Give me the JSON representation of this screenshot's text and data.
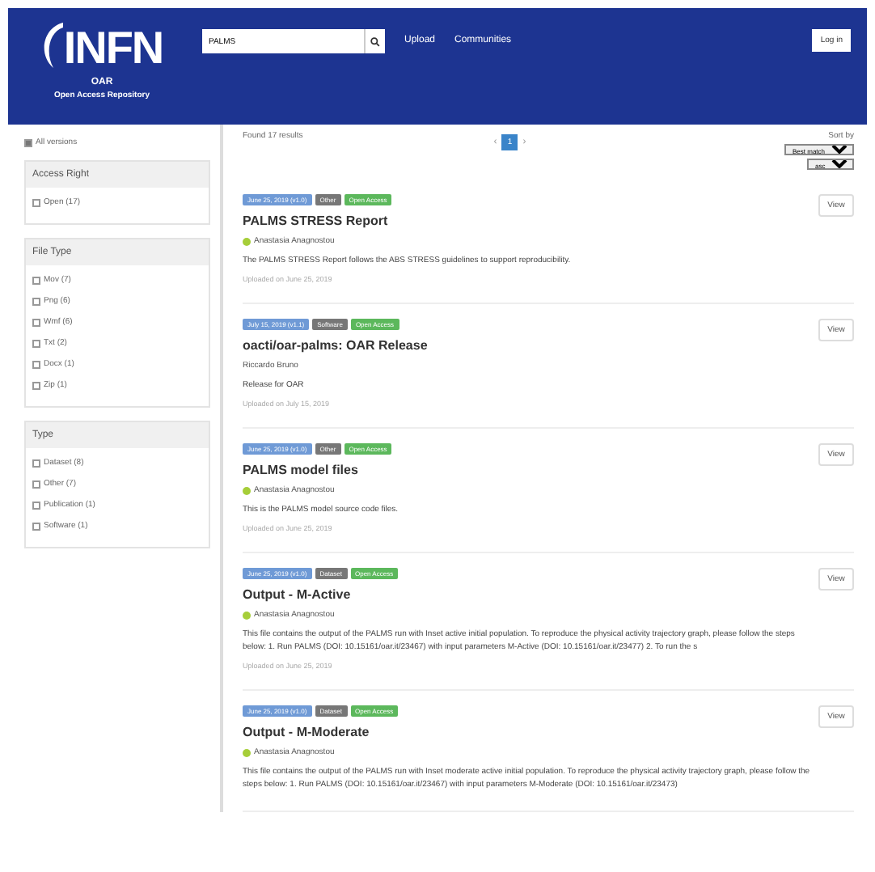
{
  "header": {
    "logo": "INFN",
    "logo_sub": "OAR",
    "logo_tagline": "Open Access Repository",
    "search": {
      "value": "PALMS"
    },
    "links": [
      "Upload",
      "Communities"
    ],
    "login": "Log in"
  },
  "sidebar": {
    "all_versions": {
      "label": "All versions",
      "checked": true
    },
    "facets": [
      {
        "title": "Access Right",
        "options": [
          {
            "label": "Open (17)",
            "checked": false
          }
        ]
      },
      {
        "title": "File Type",
        "options": [
          {
            "label": "Mov (7)",
            "checked": false
          },
          {
            "label": "Png (6)",
            "checked": false
          },
          {
            "label": "Wmf (6)",
            "checked": false
          },
          {
            "label": "Txt (2)",
            "checked": false
          },
          {
            "label": "Docx (1)",
            "checked": false
          },
          {
            "label": "Zip (1)",
            "checked": false
          }
        ]
      },
      {
        "title": "Type",
        "options": [
          {
            "label": "Dataset (8)",
            "checked": false
          },
          {
            "label": "Other (7)",
            "checked": false
          },
          {
            "label": "Publication (1)",
            "checked": false
          },
          {
            "label": "Software (1)",
            "checked": false
          }
        ]
      }
    ]
  },
  "results": {
    "count": "Found 17 results",
    "pages": [
      {
        "label": "1",
        "selected": true
      }
    ],
    "prev": "‹",
    "next": "›",
    "sort_label": "Sort by",
    "sort": "Best match",
    "order": "asc",
    "records": [
      {
        "date": "June 25, 2019 (v1.0)",
        "type": "Other",
        "access": "Open Access",
        "title": "PALMS STRESS Report",
        "author": "Anastasia Anagnostou",
        "has_orcid": true,
        "description": "The PALMS STRESS Report follows the ABS STRESS guidelines to support reproducibility.",
        "uploaded": "Uploaded on June 25, 2019",
        "view": "View"
      },
      {
        "date": "July 15, 2019 (v1.1)",
        "type": "Software",
        "access": "Open Access",
        "title": "oacti/oar-palms: OAR Release",
        "author": "Riccardo Bruno",
        "has_orcid": false,
        "description": "Release for OAR",
        "uploaded": "Uploaded on July 15, 2019",
        "view": "View"
      },
      {
        "date": "June 25, 2019 (v1.0)",
        "type": "Other",
        "access": "Open Access",
        "title": "PALMS model files",
        "author": "Anastasia Anagnostou",
        "has_orcid": true,
        "description": "This is the PALMS model source code files.",
        "uploaded": "Uploaded on June 25, 2019",
        "view": "View"
      },
      {
        "date": "June 25, 2019 (v1.0)",
        "type": "Dataset",
        "access": "Open Access",
        "title": "Output - M-Active",
        "author": "Anastasia Anagnostou",
        "has_orcid": true,
        "description": "This file contains the output of the PALMS run with Inset active initial population. To reproduce the physical activity trajectory graph, please follow the steps below: 1. Run PALMS (DOI: 10.15161/oar.it/23467) with input parameters M-Active (DOI: 10.15161/oar.it/23477) 2. To run the s",
        "uploaded": "Uploaded on June 25, 2019",
        "view": "View"
      },
      {
        "date": "June 25, 2019 (v1.0)",
        "type": "Dataset",
        "access": "Open Access",
        "title": "Output - M-Moderate",
        "author": "Anastasia Anagnostou",
        "has_orcid": true,
        "description": "This file contains the output of the PALMS run with Inset moderate active initial population. To reproduce the physical activity trajectory graph, please follow the steps below: 1. Run PALMS (DOI: 10.15161/oar.it/23467) with input parameters M-Moderate (DOI: 10.15161/oar.it/23473)",
        "view": "View"
      }
    ]
  }
}
